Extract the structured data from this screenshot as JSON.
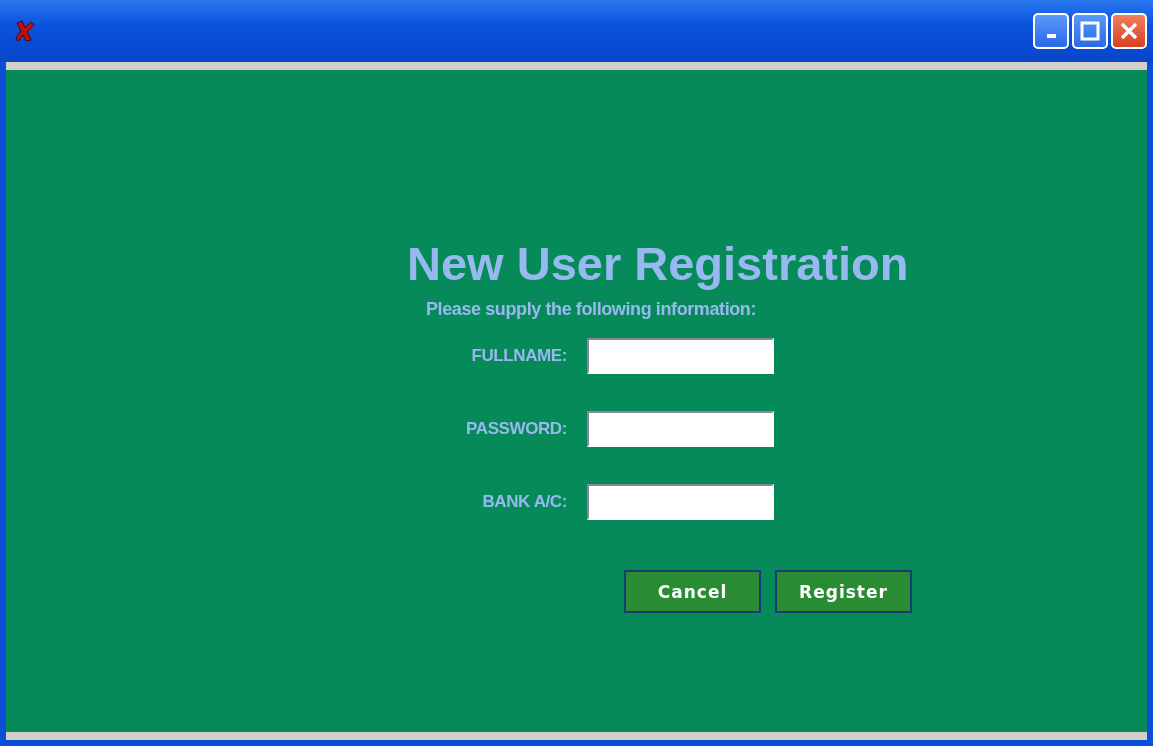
{
  "form": {
    "title": "New User Registration",
    "subtitle": "Please supply the following information:",
    "fields": [
      {
        "label": "FULLNAME:"
      },
      {
        "label": "PASSWORD:"
      },
      {
        "label": "BANK A/C:"
      }
    ],
    "buttons": [
      {
        "label": "Cancel"
      },
      {
        "label": "Register"
      }
    ]
  }
}
